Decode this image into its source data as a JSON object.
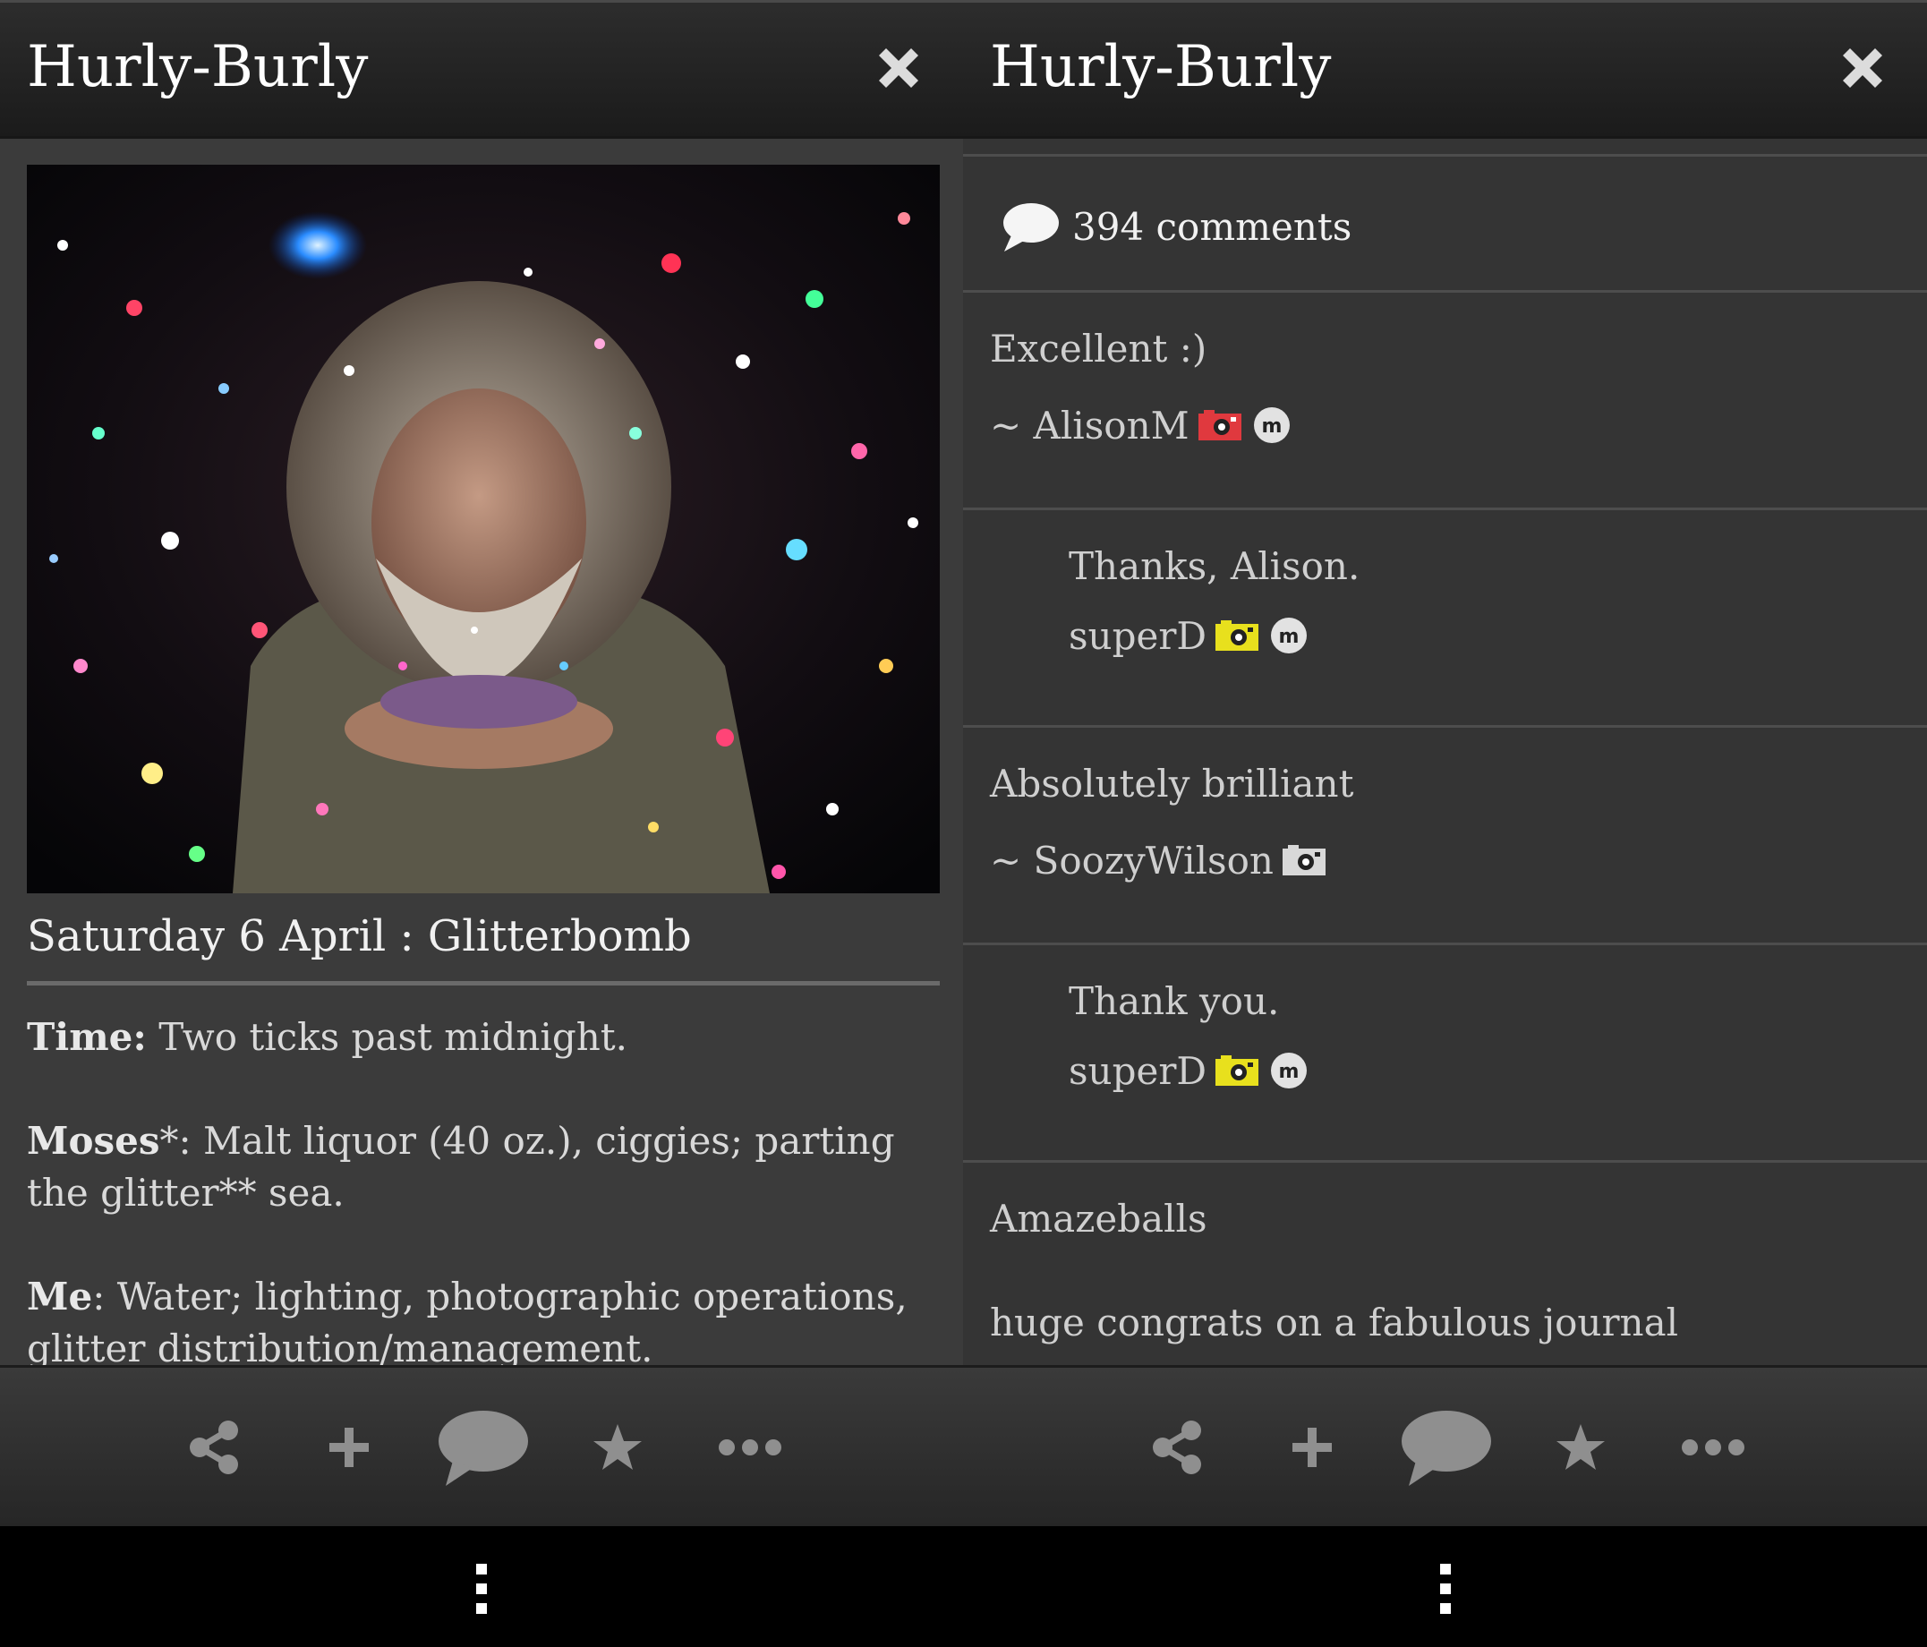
{
  "left": {
    "app_title": "Hurly-Burly",
    "post_title": "Saturday 6 April : Glitterbomb",
    "body": [
      {
        "label": "Time",
        "suffix": ":",
        "text": " Two ticks past midnight."
      },
      {
        "label": "Moses",
        "suffix": "*:",
        "text": " Malt liquor (40 oz.), ciggies; parting the glitter** sea."
      },
      {
        "label": "Me",
        "suffix": ":",
        "text": " Water; lighting, photographic operations, glitter distribution/management."
      }
    ]
  },
  "right": {
    "app_title": "Hurly-Burly",
    "comments_count": "394 comments",
    "comments": [
      {
        "text": "Excellent :)",
        "author": "~ AlisonM",
        "badge_color": "#e0393e",
        "has_m_badge": true,
        "indent": false
      },
      {
        "text": "Thanks, Alison.",
        "author": "superD",
        "badge_color": "#e8e01d",
        "has_m_badge": true,
        "indent": true
      },
      {
        "text": "Absolutely brilliant",
        "author": "~ SoozyWilson",
        "badge_color": "#d8d8d8",
        "has_m_badge": false,
        "indent": false
      },
      {
        "text": "Thank you.",
        "author": "superD",
        "badge_color": "#e8e01d",
        "has_m_badge": true,
        "indent": true
      },
      {
        "text": "Amazeballs",
        "author": "",
        "indent": false
      },
      {
        "text": "huge congrats on a fabulous journal",
        "author": "",
        "indent": false
      }
    ]
  },
  "action_bar": {
    "icons": [
      "share-icon",
      "add-icon",
      "comment-icon",
      "favorite-star-icon",
      "more-icon"
    ],
    "icon_color": "#8f8f8f"
  },
  "colors": {
    "background": "#3b3b3b",
    "topbar": "#222222",
    "title_text": "#ffffff",
    "body_text": "#d9d9d9"
  }
}
